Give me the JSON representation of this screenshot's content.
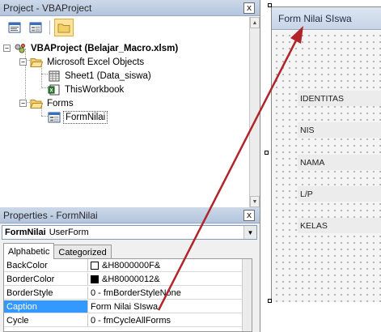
{
  "project_pane": {
    "title": "Project - VBAProject",
    "close_glyph": "x",
    "toolbar": [
      {
        "icon": "view-code-icon"
      },
      {
        "icon": "view-object-icon"
      },
      {
        "icon": "toggle-folders-icon",
        "active": true
      }
    ],
    "tree": {
      "root": "VBAProject (Belajar_Macro.xlsm)",
      "excel_objects_folder": "Microsoft Excel Objects",
      "sheet1": "Sheet1 (Data_siswa)",
      "thisworkbook": "ThisWorkbook",
      "forms_folder": "Forms",
      "formnilai": "FormNilai"
    }
  },
  "properties_pane": {
    "title": "Properties - FormNilai",
    "close_glyph": "x",
    "object_name": "FormNilai",
    "object_type": "UserForm",
    "tabs": [
      "Alphabetic",
      "Categorized"
    ],
    "active_tab": "Alphabetic",
    "rows": [
      {
        "name": "BackColor",
        "value": "&H8000000F&",
        "swatch": "#ffffff"
      },
      {
        "name": "BorderColor",
        "value": "&H80000012&",
        "swatch": "#000000"
      },
      {
        "name": "BorderStyle",
        "value": "0 - fmBorderStyleNone"
      },
      {
        "name": "Caption",
        "value": "Form Nilai SIswa",
        "selected": true
      },
      {
        "name": "Cycle",
        "value": "0 - fmCycleAllForms"
      }
    ]
  },
  "form_designer": {
    "caption": "Form Nilai SIswa",
    "labels": [
      "IDENTITAS",
      "NIS",
      "NAMA",
      "L/P",
      "KELAS"
    ]
  },
  "colors": {
    "arrow": "#b0242a",
    "selection": "#3399ff",
    "title_gradient_top": "#cdd9ea",
    "title_gradient_bottom": "#b3c4dc"
  }
}
